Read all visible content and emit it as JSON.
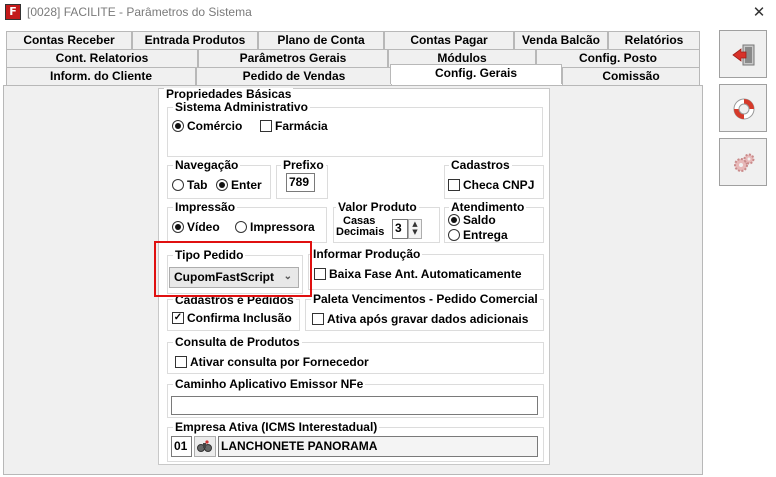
{
  "window": {
    "title": "[0028] FACILITE - Parâmetros do Sistema",
    "app_icon_letter": "F",
    "close_glyph": "✕"
  },
  "tabs": {
    "row1": [
      "Contas Receber",
      "Entrada Produtos",
      "Plano de Conta",
      "Contas Pagar",
      "Venda Balcão",
      "Relatórios"
    ],
    "row2": [
      "Cont. Relatorios",
      "Parâmetros Gerais",
      "Módulos",
      "Config. Posto"
    ],
    "row3": [
      "Inform. do Cliente",
      "Pedido de Vendas",
      "Config. Gerais",
      "Comissão"
    ],
    "active": "Config. Gerais"
  },
  "props": {
    "title": "Propriedades Básicas",
    "sistema": {
      "label": "Sistema Administrativo",
      "comercio": "Comércio",
      "farmacia": "Farmácia",
      "selected": "Comércio",
      "farmacia_checked": false
    },
    "navegacao": {
      "label": "Navegação",
      "tab": "Tab",
      "enter": "Enter",
      "selected": "Enter"
    },
    "prefixo": {
      "label": "Prefixo",
      "value": "789"
    },
    "cadastros": {
      "label": "Cadastros",
      "checa_cnpj": "Checa CNPJ",
      "checked": false
    },
    "impressao": {
      "label": "Impressão",
      "video": "Vídeo",
      "impressora": "Impressora",
      "selected": "Vídeo"
    },
    "valor_produto": {
      "label": "Valor Produto",
      "casas": "Casas",
      "decimais": "Decimais",
      "value": "3"
    },
    "atendimento": {
      "label": "Atendimento",
      "saldo": "Saldo",
      "entrega": "Entrega",
      "selected": "Saldo"
    },
    "tipo_pedido": {
      "label": "Tipo Pedido",
      "value": "CupomFastScript"
    },
    "informar_producao": {
      "label": "Informar Produção",
      "baixa": "Baixa Fase Ant. Automaticamente",
      "checked": false
    },
    "cadastros_pedidos": {
      "label": "Cadastros e Pedidos",
      "confirma": "Confirma Inclusão",
      "checked": true
    },
    "paleta": {
      "label": "Paleta Vencimentos - Pedido Comercial",
      "ativa": "Ativa após gravar dados adicionais",
      "checked": false
    },
    "consulta": {
      "label": "Consulta de Produtos",
      "ativar": "Ativar consulta por Fornecedor",
      "checked": false
    },
    "caminho": {
      "label": "Caminho Aplicativo Emissor NFe",
      "value": ""
    },
    "empresa": {
      "label": "Empresa Ativa (ICMS Interestadual)",
      "code": "01",
      "name": "LANCHONETE PANORAMA"
    }
  },
  "toolbar": {
    "exit_icon": "exit-door-icon",
    "help_icon": "lifebuoy-icon",
    "settings_icon": "gears-icon"
  },
  "colors": {
    "highlight": "#e01010",
    "exit_red": "#d8322a",
    "lifebuoy_red": "#d63a2a"
  }
}
